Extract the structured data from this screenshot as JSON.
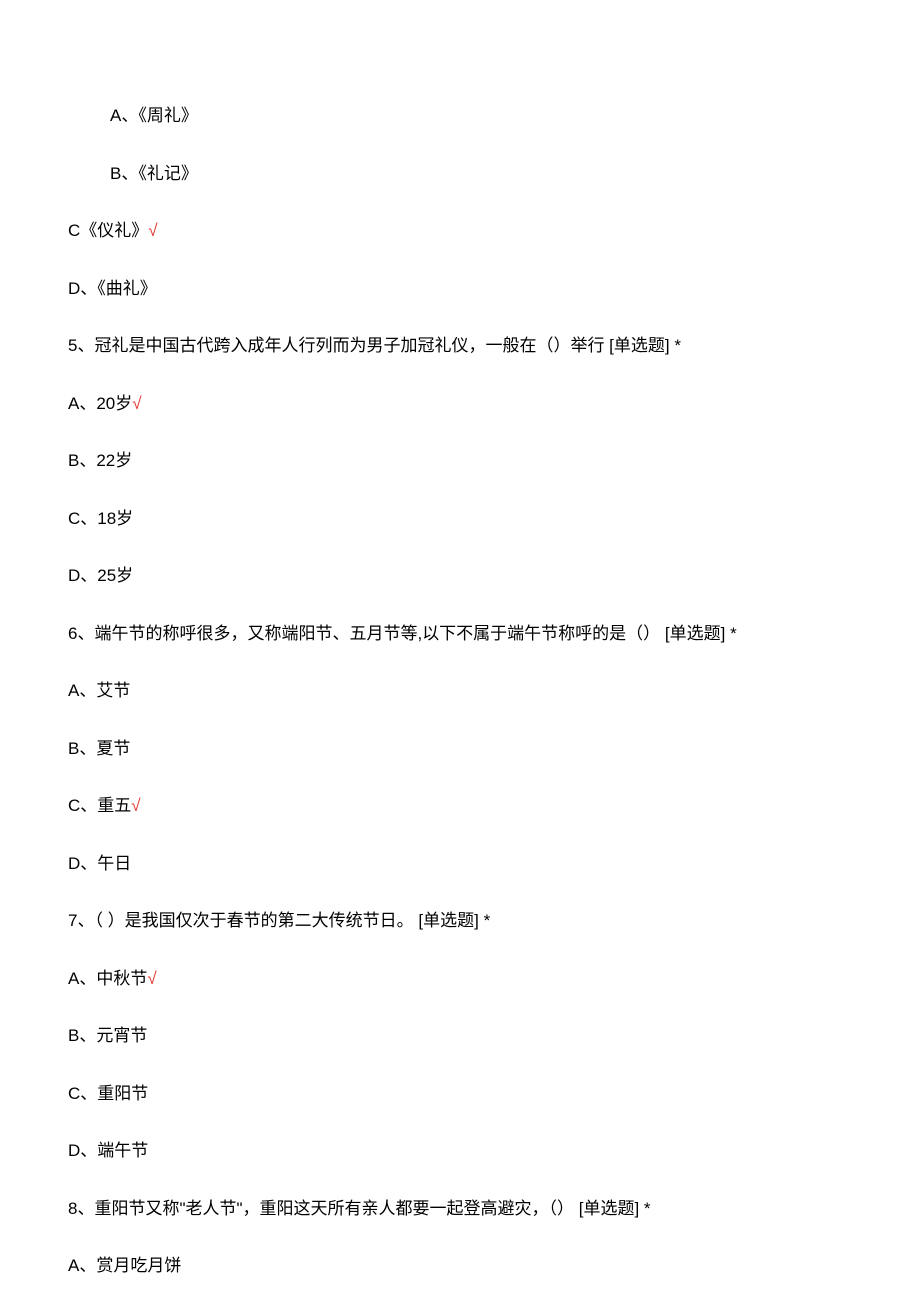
{
  "q4_option_a_indent": "A、《周礼》",
  "q4_option_b_indent": "B、《礼记》",
  "q4_option_c_text": "C《仪礼》",
  "q4_option_c_mark": "√",
  "q4_option_d": "D、《曲礼》",
  "q5_text": "5、冠礼是中国古代跨入成年人行列而为男子加冠礼仪，一般在（）举行  [单选题]  *",
  "q5_option_a_text": "A、20岁",
  "q5_option_a_mark": "√",
  "q5_option_b": "B、22岁",
  "q5_option_c": "C、18岁",
  "q5_option_d": "D、25岁",
  "q6_text": "6、端午节的称呼很多，又称端阳节、五月节等,以下不属于端午节称呼的是（）   [单选题]  *",
  "q6_option_a": "A、艾节",
  "q6_option_b": "B、夏节",
  "q6_option_c_text": "C、重五",
  "q6_option_c_mark": "√",
  "q6_option_d": "D、午日",
  "q7_text": "7、（  ）是我国仅次于春节的第二大传统节日。  [单选题]  *",
  "q7_option_a_text": "A、中秋节",
  "q7_option_a_mark": "√",
  "q7_option_b": "B、元宵节",
  "q7_option_c": "C、重阳节",
  "q7_option_d": "D、端午节",
  "q8_text": "8、重阳节又称\"老人节\"，重阳这天所有亲人都要一起登高避灾，（）  [单选题]  *",
  "q8_option_a": "A、赏月吃月饼"
}
